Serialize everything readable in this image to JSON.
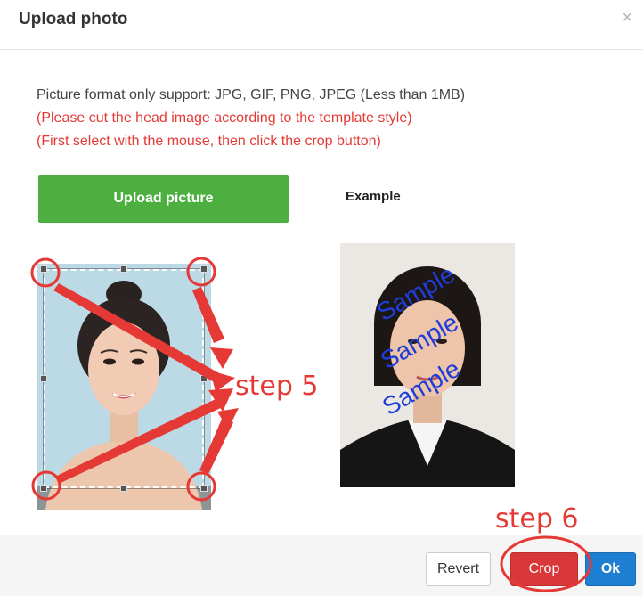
{
  "dialog": {
    "title": "Upload photo",
    "close_symbol": "×"
  },
  "info": {
    "format_text": "Picture format only support: JPG, GIF, PNG, JPEG (Less than 1MB)",
    "note_cut": "(Please cut the head image according to the template style)",
    "note_select": "(First select with the mouse, then click the crop button)"
  },
  "upload": {
    "button_label": "Upload picture"
  },
  "example": {
    "label": "Example",
    "watermark": "Sample"
  },
  "annotations": {
    "step5": "step 5",
    "step6": "step 6",
    "color": "#e53935"
  },
  "footer": {
    "revert_label": "Revert",
    "crop_label": "Crop",
    "ok_label": "Ok"
  },
  "colors": {
    "upload_green": "#4caf3f",
    "crop_red": "#d9383a",
    "ok_blue": "#1e7ed2",
    "note_red": "#e53935",
    "watermark_blue": "#1f3ed8"
  }
}
